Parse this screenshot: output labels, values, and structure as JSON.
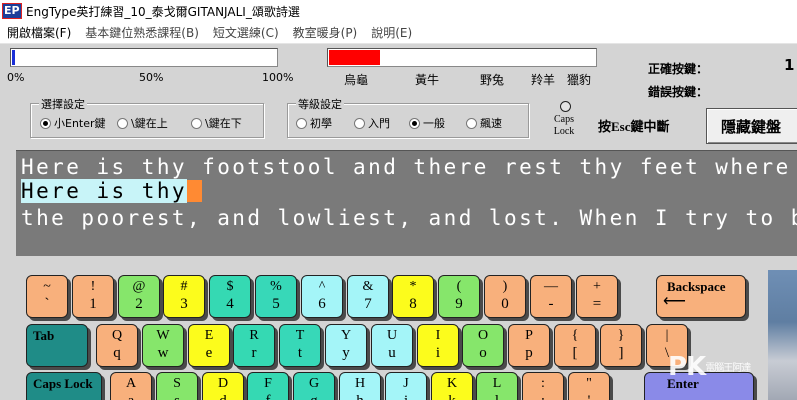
{
  "window": {
    "title": "EngType英打練習_10_泰戈爾GITANJALI_頌歌詩選",
    "icon": "eng-type-app-icon"
  },
  "menu": [
    "開啟檔案(F)",
    "基本鍵位熟悉課程(B)",
    "短文選練(C)",
    "教室暖身(P)",
    "說明(E)"
  ],
  "progress": {
    "value": 0.01,
    "ticks": [
      "0%",
      "50%",
      "100%"
    ]
  },
  "speed": {
    "value": 0.19,
    "labels": [
      "烏龜",
      "黃牛",
      "野兔",
      "羚羊",
      "獵豹"
    ]
  },
  "stats": {
    "correct_label": "正確按鍵：",
    "correct_value": "1",
    "error_label": "錯誤按鍵：",
    "error_value": ""
  },
  "mode_group": {
    "legend": "選擇設定",
    "options": [
      "小Enter鍵",
      "\\鍵在上",
      "\\鍵在下"
    ],
    "selected": 0
  },
  "level_group": {
    "legend": "等級設定",
    "options": [
      "初學",
      "入門",
      "一般",
      "飆速"
    ],
    "selected": 2
  },
  "caps": {
    "label_line1": "Caps",
    "label_line2": "Lock"
  },
  "esc_note": "按Esc鍵中斷",
  "hide_keyboard_button": "隱藏鍵盤",
  "text": {
    "line1": "Here is thy footstool and there rest thy feet where live",
    "typed": "Here is thy",
    "line3": "the poorest, and lowliest, and lost. When I try to bow"
  },
  "keyboard": {
    "row1": [
      {
        "top": "~",
        "bot": "`",
        "color": "#f8b07c"
      },
      {
        "top": "!",
        "bot": "1",
        "color": "#f8b07c"
      },
      {
        "top": "@",
        "bot": "2",
        "color": "#86e66b"
      },
      {
        "top": "#",
        "bot": "3",
        "color": "#fcfc1c"
      },
      {
        "top": "$",
        "bot": "4",
        "color": "#35d9b3"
      },
      {
        "top": "%",
        "bot": "5",
        "color": "#37d8b8"
      },
      {
        "top": "^",
        "bot": "6",
        "color": "#a4f5f8"
      },
      {
        "top": "&",
        "bot": "7",
        "color": "#a4f5f8"
      },
      {
        "top": "*",
        "bot": "8",
        "color": "#fcfc1c"
      },
      {
        "top": "(",
        "bot": "9",
        "color": "#86e66b"
      },
      {
        "top": ")",
        "bot": "0",
        "color": "#f8b07c"
      },
      {
        "top": "—",
        "bot": "-",
        "color": "#f8b07c"
      },
      {
        "top": "+",
        "bot": "=",
        "color": "#f8b07c"
      }
    ],
    "backspace": "Backspace",
    "tab": "Tab",
    "row2": [
      {
        "top": "Q",
        "bot": "q",
        "color": "#f8b07c"
      },
      {
        "top": "W",
        "bot": "w",
        "color": "#86e66b"
      },
      {
        "top": "E",
        "bot": "e",
        "color": "#fcfc1c"
      },
      {
        "top": "R",
        "bot": "r",
        "color": "#35d9b3"
      },
      {
        "top": "T",
        "bot": "t",
        "color": "#37d8b8"
      },
      {
        "top": "Y",
        "bot": "y",
        "color": "#a4f5f8"
      },
      {
        "top": "U",
        "bot": "u",
        "color": "#a4f5f8"
      },
      {
        "top": "I",
        "bot": "i",
        "color": "#fcfc1c"
      },
      {
        "top": "O",
        "bot": "o",
        "color": "#86e66b"
      },
      {
        "top": "P",
        "bot": "p",
        "color": "#f8b07c"
      },
      {
        "top": "{",
        "bot": "[",
        "color": "#f8b07c"
      },
      {
        "top": "}",
        "bot": "]",
        "color": "#f8b07c"
      },
      {
        "top": "|",
        "bot": "\\",
        "color": "#f8b07c"
      }
    ],
    "caps_lock": "Caps Lock",
    "row3": [
      {
        "top": "A",
        "bot": "a",
        "color": "#f8b07c"
      },
      {
        "top": "S",
        "bot": "s",
        "color": "#86e66b"
      },
      {
        "top": "D",
        "bot": "d",
        "color": "#fcfc1c"
      },
      {
        "top": "F",
        "bot": "f",
        "color": "#35d9b3"
      },
      {
        "top": "G",
        "bot": "g",
        "color": "#37d8b8"
      },
      {
        "top": "H",
        "bot": "h",
        "color": "#a4f5f8"
      },
      {
        "top": "J",
        "bot": "j",
        "color": "#a4f5f8"
      },
      {
        "top": "K",
        "bot": "k",
        "color": "#fcfc1c"
      },
      {
        "top": "L",
        "bot": "l",
        "color": "#86e66b"
      },
      {
        "top": ":",
        "bot": ";",
        "color": "#f8b07c"
      },
      {
        "top": "\"",
        "bot": "'",
        "color": "#f8b07c"
      }
    ],
    "enter": "Enter"
  },
  "watermark": {
    "big": "PK",
    "small": "電腦王阿達"
  }
}
